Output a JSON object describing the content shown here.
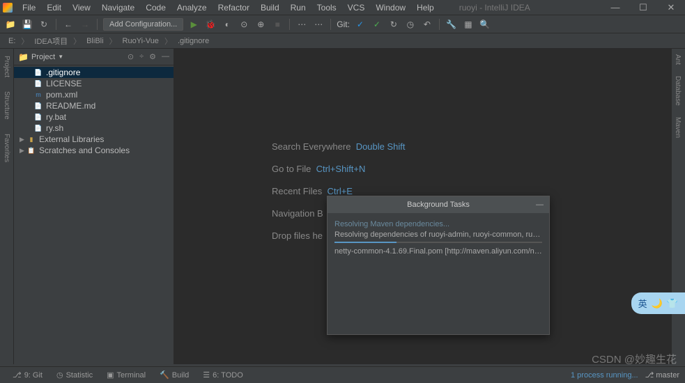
{
  "menubar": {
    "items": [
      "File",
      "Edit",
      "View",
      "Navigate",
      "Code",
      "Analyze",
      "Refactor",
      "Build",
      "Run",
      "Tools",
      "VCS",
      "Window",
      "Help"
    ],
    "title": "ruoyi - IntelliJ IDEA"
  },
  "toolbar": {
    "config": "Add Configuration...",
    "git_label": "Git:"
  },
  "breadcrumb": {
    "items": [
      "E:",
      "IDEA项目",
      "BliBli",
      "RuoYi-Vue",
      ".gitignore"
    ]
  },
  "sidebar": {
    "title": "Project",
    "items": [
      {
        "name": ".gitignore",
        "icon": "file",
        "selected": true
      },
      {
        "name": "LICENSE",
        "icon": "file"
      },
      {
        "name": "pom.xml",
        "icon": "maven"
      },
      {
        "name": "README.md",
        "icon": "md"
      },
      {
        "name": "ry.bat",
        "icon": "file"
      },
      {
        "name": "ry.sh",
        "icon": "file"
      },
      {
        "name": "External Libraries",
        "icon": "lib",
        "arrow": "▶"
      },
      {
        "name": "Scratches and Consoles",
        "icon": "scratch",
        "arrow": "▶"
      }
    ]
  },
  "leftbar": [
    "Project",
    "Structure",
    "Favorites"
  ],
  "rightbar": [
    "Ant",
    "Database",
    "Maven"
  ],
  "tips": {
    "l1": "Search Everywhere",
    "s1": "Double Shift",
    "l2": "Go to File",
    "s2": "Ctrl+Shift+N",
    "l3": "Recent Files",
    "s3": "Ctrl+E",
    "l4": "Navigation B",
    "l5": "Drop files he"
  },
  "popup": {
    "title": "Background Tasks",
    "task": "Resolving Maven dependencies...",
    "line1": "Resolving dependencies of ruoyi-admin, ruoyi-common, ruoyi-...",
    "line2": "netty-common-4.1.69.Final.pom [http://maven.aliyun.com/nex..."
  },
  "statusbar": {
    "items": [
      "9: Git",
      "Statistic",
      "Terminal",
      "Build",
      "6: TODO"
    ],
    "proc": "1 process running...",
    "branch": "master"
  },
  "watermark": "CSDN @妙趣生花",
  "ime": "英"
}
